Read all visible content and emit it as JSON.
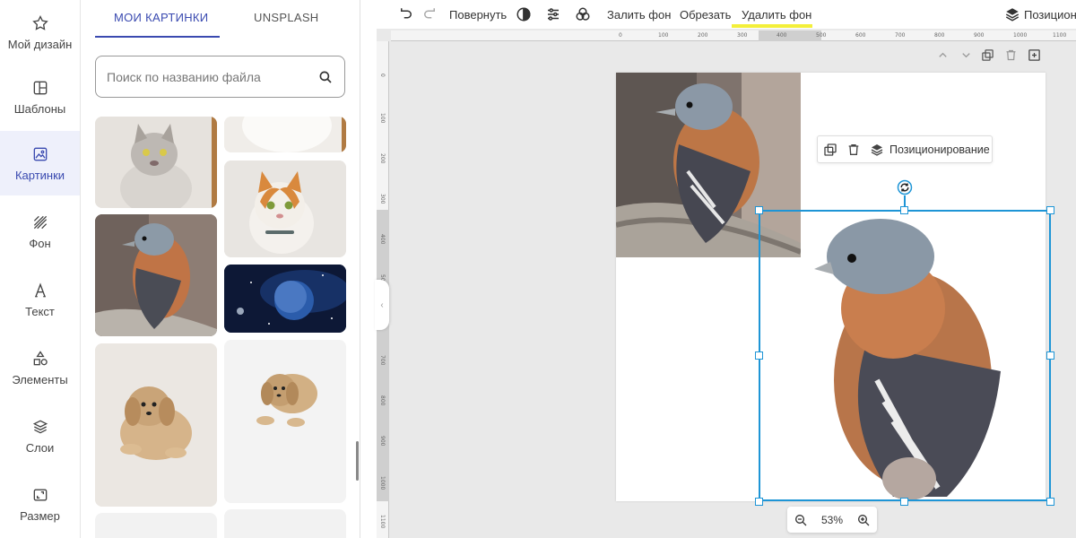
{
  "nav": {
    "items": [
      {
        "label": "Мой дизайн",
        "icon": "star-icon"
      },
      {
        "label": "Шаблоны",
        "icon": "template-icon"
      },
      {
        "label": "Картинки",
        "icon": "image-icon"
      },
      {
        "label": "Фон",
        "icon": "background-hatch-icon"
      },
      {
        "label": "Текст",
        "icon": "text-icon"
      },
      {
        "label": "Элементы",
        "icon": "shapes-icon"
      },
      {
        "label": "Слои",
        "icon": "layers-icon"
      },
      {
        "label": "Размер",
        "icon": "resize-icon"
      }
    ],
    "active_index": 2
  },
  "panel": {
    "tabs": [
      {
        "label": "МОИ КАРТИНКИ"
      },
      {
        "label": "UNSPLASH"
      }
    ],
    "search_placeholder": "Поиск по названию файла"
  },
  "toolbar": {
    "rotate_label": "Повернуть",
    "fill_bg_label": "Залить фон",
    "crop_label": "Обрезать",
    "remove_bg_label": "Удалить фон",
    "position_label": "Позициони"
  },
  "context_menu": {
    "position_label": "Позиционирование"
  },
  "ruler": {
    "top_ticks": [
      "0",
      "100",
      "200",
      "300",
      "400",
      "500",
      "600",
      "700",
      "800",
      "900",
      "1000",
      "1100"
    ],
    "left_ticks": [
      "0",
      "100",
      "200",
      "300",
      "400",
      "500",
      "600",
      "700",
      "800",
      "900",
      "1000",
      "1100"
    ]
  },
  "zoom": {
    "value": "53%"
  },
  "colors": {
    "accent": "#3a4ab0",
    "selection": "#1e95d6",
    "highlight": "#f3ef3a",
    "canvas_bg": "#e9e9e9"
  }
}
